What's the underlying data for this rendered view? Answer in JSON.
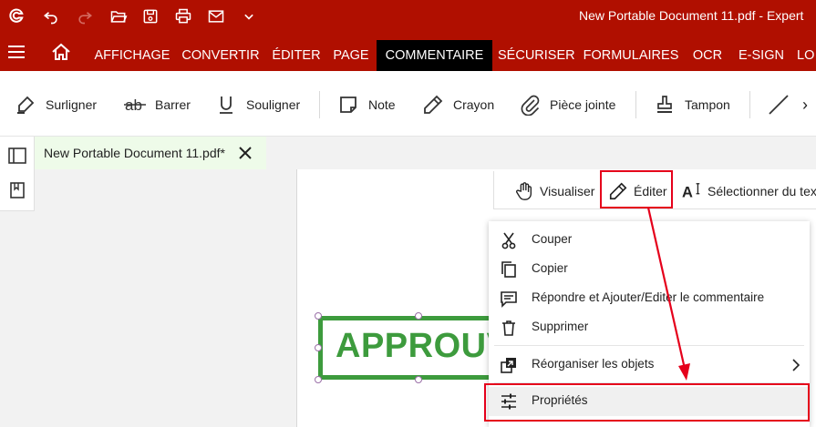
{
  "titlebar": {
    "window_title": "New Portable Document 11.pdf   -   Expert",
    "icons": [
      "app-logo-icon",
      "undo-icon",
      "redo-icon",
      "open-folder-icon",
      "save-icon",
      "print-icon",
      "email-icon",
      "chevron-down-icon"
    ]
  },
  "ribbon": {
    "tabs": [
      {
        "label": "AFFICHAGE"
      },
      {
        "label": "CONVERTIR"
      },
      {
        "label": "ÉDITER"
      },
      {
        "label": "PAGE"
      },
      {
        "label": "COMMENTAIRE"
      },
      {
        "label": "SÉCURISER"
      },
      {
        "label": "FORMULAIRES"
      },
      {
        "label": "OCR"
      },
      {
        "label": "E-SIGN"
      },
      {
        "label": "LO"
      }
    ],
    "active_tab": "COMMENTAIRE"
  },
  "toolbar": {
    "highlight": "Surligner",
    "strike": "Barrer",
    "underline": "Souligner",
    "note": "Note",
    "pencil": "Crayon",
    "attachment": "Pièce jointe",
    "stamp": "Tampon",
    "more": "›"
  },
  "document_tab": {
    "title": "New Portable Document 11.pdf*"
  },
  "stamp": {
    "text": "APPROUVE",
    "color": "#3d9b3d"
  },
  "modes": {
    "view": "Visualiser",
    "edit": "Éditer",
    "select_text": "Sélectionner du texte"
  },
  "context_menu": {
    "items": [
      {
        "label": "Couper"
      },
      {
        "label": "Copier"
      },
      {
        "label": "Répondre et Ajouter/Editer le commentaire"
      },
      {
        "label": "Supprimer"
      },
      {
        "label": "Réorganiser les objets"
      },
      {
        "label": "Propriétés"
      }
    ]
  },
  "colors": {
    "brand": "#b00f00",
    "active_tab": "#000000",
    "callout": "#e5001b"
  }
}
